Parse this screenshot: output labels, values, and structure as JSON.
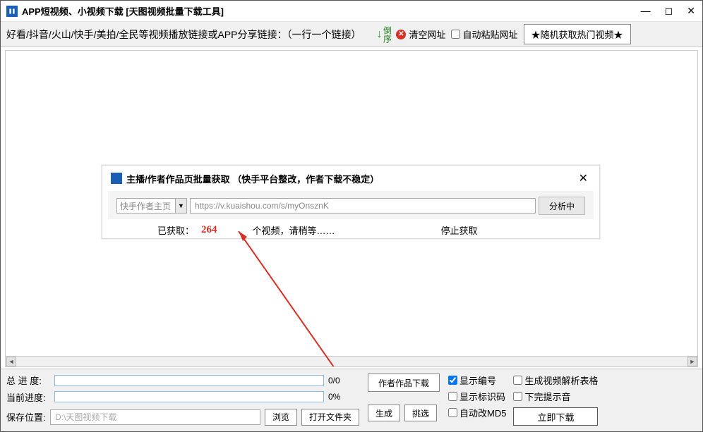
{
  "titlebar": {
    "title": "APP短视频、小视频下载 [天图视频批量下载工具]"
  },
  "toolbar": {
    "hint": "好看/抖音/火山/快手/美拍/全民等视频播放链接或APP分享链接：（一行一个链接）",
    "reverse": "倒序",
    "clear": "清空网址",
    "autopaste": "自动粘贴网址",
    "star": "★随机获取热门视频★"
  },
  "dialog": {
    "title": "主播/作者作品页批量获取 （快手平台整改，作者下载不稳定）",
    "select_placeholder": "快手作者主页",
    "url": "https://v.kuaishou.com/s/myOnsznK",
    "analyze": "分析中",
    "status_label": "已获取：",
    "status_count": "264",
    "status_mid": "个视频，请稍等……",
    "status_right": "停止获取"
  },
  "bottom": {
    "total_label": "总 进 度:",
    "total_val": "0/0",
    "current_label": "当前进度:",
    "current_val": "0%",
    "path_label": "保存位置:",
    "path_value": "D:\\天图视频下载",
    "browse": "浏览",
    "openfolder": "打开文件夹",
    "author_dl": "作者作品下载",
    "gen": "生成",
    "pick": "挑选",
    "show_num": "显示编号",
    "show_id": "显示标识码",
    "auto_md5": "自动改MD5",
    "gen_table": "生成视频解析表格",
    "done_sound": "下完提示音",
    "download": "立即下载"
  }
}
